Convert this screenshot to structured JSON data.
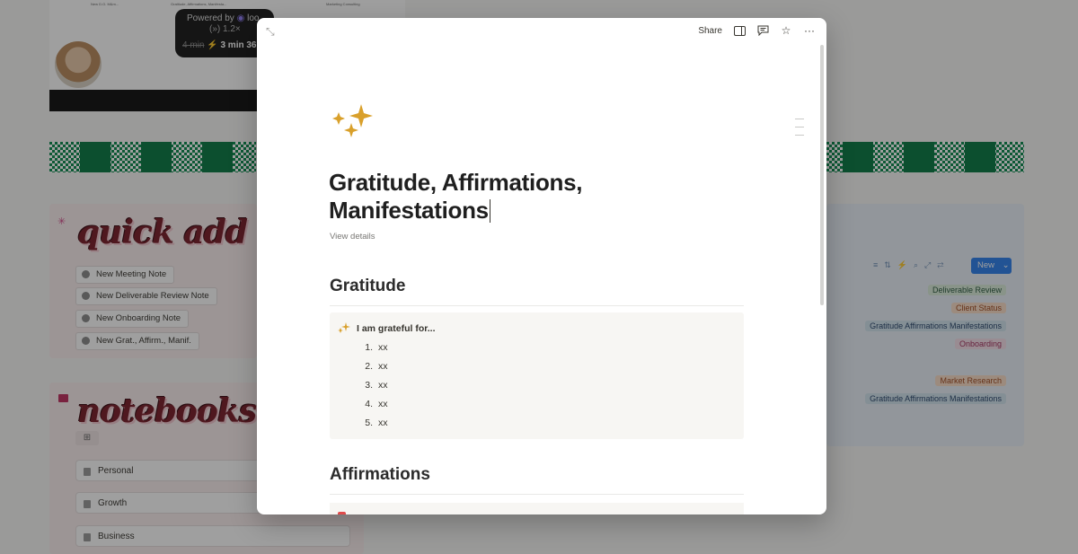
{
  "background": {
    "loom": {
      "powered_by": "Powered by",
      "brand": "loo",
      "speed_fragment": "(»)  1.2×",
      "time_original": "4 min",
      "time_fast": "⚡ 3 min 36"
    },
    "mini_labels": [
      "New D.O. M&m...",
      "Gratitude, Affirmations, Manifesta...",
      "Marketing Consulting"
    ],
    "quick_add": {
      "title": "quick add",
      "buttons": [
        "New Meeting Note",
        "New Deliverable Review Note",
        "New Onboarding Note",
        "New Grat., Affirm., Manif."
      ]
    },
    "notebooks": {
      "title": "notebooks",
      "items": [
        "Personal",
        "Growth",
        "Business"
      ]
    },
    "database": {
      "new_label": "New",
      "tags": [
        {
          "label": "Deliverable Review",
          "bg": "#dbeddb",
          "fg": "#2b593f"
        },
        {
          "label": "Client Status",
          "bg": "#fadec9",
          "fg": "#a14b20"
        },
        {
          "label": "Gratitude Affirmations Manifestations",
          "bg": "#d3e5ef",
          "fg": "#28456c"
        },
        {
          "label": "Onboarding",
          "bg": "#f5e0e9",
          "fg": "#a3305e"
        },
        {
          "label": "Market Research",
          "bg": "#fadec9",
          "fg": "#a14b20"
        },
        {
          "label": "Gratitude Affirmations Manifestations",
          "bg": "#d3e5ef",
          "fg": "#28456c"
        }
      ]
    }
  },
  "modal": {
    "topbar": {
      "expand_icon": "expand-icon",
      "share_label": "Share",
      "icons": [
        "sidebar-icon",
        "comment-icon",
        "star-icon",
        "more-icon"
      ]
    },
    "page_icon": "sparkles-icon",
    "title_line1": "Gratitude, Affirmations,",
    "title_line2": "Manifestations",
    "view_details": "View details",
    "sections": {
      "gratitude": {
        "heading": "Gratitude",
        "callout_title": "I am grateful for...",
        "items": [
          "xx",
          "xx",
          "xx",
          "xx",
          "xx"
        ]
      },
      "affirmations": {
        "heading": "Affirmations"
      }
    }
  },
  "colors": {
    "accent_blue": "#2f80ed",
    "sparkle_gold": "#d9a02b",
    "checker_green": "#0d8a4f"
  }
}
